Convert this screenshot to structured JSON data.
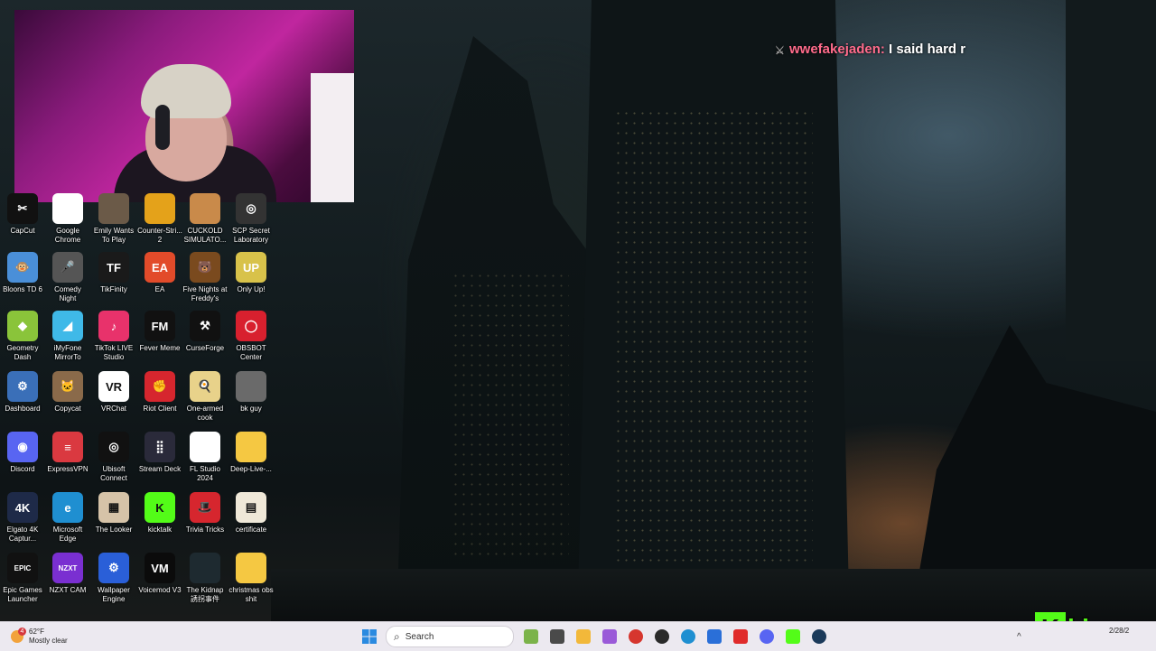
{
  "chat": {
    "username": "wwefakejaden:",
    "message": "I said hard r"
  },
  "desktop": {
    "icons": [
      {
        "label": "CapCut",
        "icon": "capcut-icon",
        "color": "#111111",
        "glyph": "✂"
      },
      {
        "label": "Google Chrome",
        "icon": "chrome-icon",
        "color": "#ffffff",
        "glyph": ""
      },
      {
        "label": "Emily Wants To Play",
        "icon": "game-icon",
        "color": "#6b5a48",
        "glyph": ""
      },
      {
        "label": "Counter-Stri... 2",
        "icon": "cs2-icon",
        "color": "#e4a21a",
        "glyph": ""
      },
      {
        "label": "CUCKOLD SIMULATO...",
        "icon": "game-icon",
        "color": "#c98a4a",
        "glyph": ""
      },
      {
        "label": "SCP Secret Laboratory",
        "icon": "scp-icon",
        "color": "#333333",
        "glyph": "◎"
      },
      {
        "label": "Bloons TD 6",
        "icon": "monkey-icon",
        "color": "#4a8fd8",
        "glyph": "🐵"
      },
      {
        "label": "Comedy Night",
        "icon": "microphone-icon",
        "color": "#555555",
        "glyph": "🎤"
      },
      {
        "label": "TikFinity",
        "icon": "tikfinity-icon",
        "color": "#1a1a1a",
        "glyph": "TF"
      },
      {
        "label": "EA",
        "icon": "ea-icon",
        "color": "#e24b2a",
        "glyph": "EA"
      },
      {
        "label": "Five Nights at Freddy's",
        "icon": "bear-icon",
        "color": "#7a4a1e",
        "glyph": "🐻"
      },
      {
        "label": "Only Up!",
        "icon": "onlyup-icon",
        "color": "#d8c24a",
        "glyph": "UP"
      },
      {
        "label": "Geometry Dash",
        "icon": "geometry-dash-icon",
        "color": "#8ac43a",
        "glyph": "◆"
      },
      {
        "label": "iMyFone MirrorTo",
        "icon": "mirror-icon",
        "color": "#3fb9e8",
        "glyph": "◢"
      },
      {
        "label": "TikTok LIVE Studio",
        "icon": "tiktok-icon",
        "color": "#e8326b",
        "glyph": "♪"
      },
      {
        "label": "Fever Meme",
        "icon": "fevermeme-icon",
        "color": "#111111",
        "glyph": "FM"
      },
      {
        "label": "CurseForge",
        "icon": "curseforge-icon",
        "color": "#111111",
        "glyph": "⚒"
      },
      {
        "label": "OBSBOT Center",
        "icon": "obsbot-icon",
        "color": "#d8202e",
        "glyph": "◯"
      },
      {
        "label": "Dashboard",
        "icon": "shield-icon",
        "color": "#3a6fb8",
        "glyph": "⚙"
      },
      {
        "label": "Copycat",
        "icon": "copycat-icon",
        "color": "#8a6a4a",
        "glyph": "🐱"
      },
      {
        "label": "VRChat",
        "icon": "vrchat-icon",
        "color": "#ffffff",
        "glyph": "VR"
      },
      {
        "label": "Riot Client",
        "icon": "riot-icon",
        "color": "#d6262e",
        "glyph": "✊"
      },
      {
        "label": "One-armed cook",
        "icon": "cook-icon",
        "color": "#e8d28a",
        "glyph": "🍳"
      },
      {
        "label": "bk guy",
        "icon": "photo-icon",
        "color": "#6a6a6a",
        "glyph": ""
      },
      {
        "label": "Discord",
        "icon": "discord-icon",
        "color": "#5865f2",
        "glyph": "◉"
      },
      {
        "label": "ExpressVPN",
        "icon": "expressvpn-icon",
        "color": "#da3940",
        "glyph": "≡"
      },
      {
        "label": "Ubisoft Connect",
        "icon": "ubisoft-icon",
        "color": "#111111",
        "glyph": "◎"
      },
      {
        "label": "Stream Deck",
        "icon": "streamdeck-icon",
        "color": "#2a2a3a",
        "glyph": "⣿"
      },
      {
        "label": "FL Studio 2024",
        "icon": "flstudio-icon",
        "color": "#ffffff",
        "glyph": ""
      },
      {
        "label": "Deep-Live-...",
        "icon": "folder-icon",
        "color": "#f5c842",
        "glyph": ""
      },
      {
        "label": "Elgato 4K Captur...",
        "icon": "elgato-icon",
        "color": "#1e2a48",
        "glyph": "4K"
      },
      {
        "label": "Microsoft Edge",
        "icon": "edge-icon",
        "color": "#1f8fd1",
        "glyph": "e"
      },
      {
        "label": "The Looker",
        "icon": "looker-icon",
        "color": "#d6c3a8",
        "glyph": "▦"
      },
      {
        "label": "kicktalk",
        "icon": "kick-icon",
        "color": "#53fc18",
        "glyph": "K"
      },
      {
        "label": "Trivia Tricks",
        "icon": "hat-icon",
        "color": "#d6262e",
        "glyph": "🎩"
      },
      {
        "label": "certificate",
        "icon": "certificate-icon",
        "color": "#efe8d8",
        "glyph": "▤"
      },
      {
        "label": "Epic Games Launcher",
        "icon": "epic-icon",
        "color": "#111111",
        "glyph": "EPIC"
      },
      {
        "label": "NZXT CAM",
        "icon": "nzxt-icon",
        "color": "#7a2fd1",
        "glyph": "NZXT"
      },
      {
        "label": "Wallpaper Engine",
        "icon": "wallpaper-icon",
        "color": "#2a5fd8",
        "glyph": "⚙"
      },
      {
        "label": "Voicemod V3",
        "icon": "voicemod-icon",
        "color": "#0b0b0b",
        "glyph": "VM"
      },
      {
        "label": "The Kidnap 誘拐事件",
        "icon": "game-icon",
        "color": "#1e2a30",
        "glyph": ""
      },
      {
        "label": "christmas obs shit",
        "icon": "folder-icon",
        "color": "#f5c842",
        "glyph": ""
      }
    ]
  },
  "taskbar": {
    "weather": {
      "temp": "62°F",
      "condition": "Mostly clear",
      "alert_count": "4"
    },
    "search_placeholder": "Search",
    "apps": [
      {
        "name": "widgets-icon",
        "color": "#7bb34a"
      },
      {
        "name": "task-view-icon",
        "color": "#4a4a4a"
      },
      {
        "name": "file-explorer-icon",
        "color": "#f2b83a"
      },
      {
        "name": "copilot-icon",
        "color": "#9a5ad8"
      },
      {
        "name": "chrome-icon",
        "color": "#d6362e"
      },
      {
        "name": "obs-icon",
        "color": "#2a2a2a"
      },
      {
        "name": "edge-icon",
        "color": "#1f8fd1"
      },
      {
        "name": "store-icon",
        "color": "#2a6fd8"
      },
      {
        "name": "youtube-icon",
        "color": "#e02b2b"
      },
      {
        "name": "discord-icon",
        "color": "#5865f2"
      },
      {
        "name": "kick-icon",
        "color": "#53fc18"
      },
      {
        "name": "steam-icon",
        "color": "#1b3a5a"
      }
    ],
    "clock_date": "2/28/2"
  },
  "brand": {
    "letter": "K",
    "name": "himay"
  }
}
